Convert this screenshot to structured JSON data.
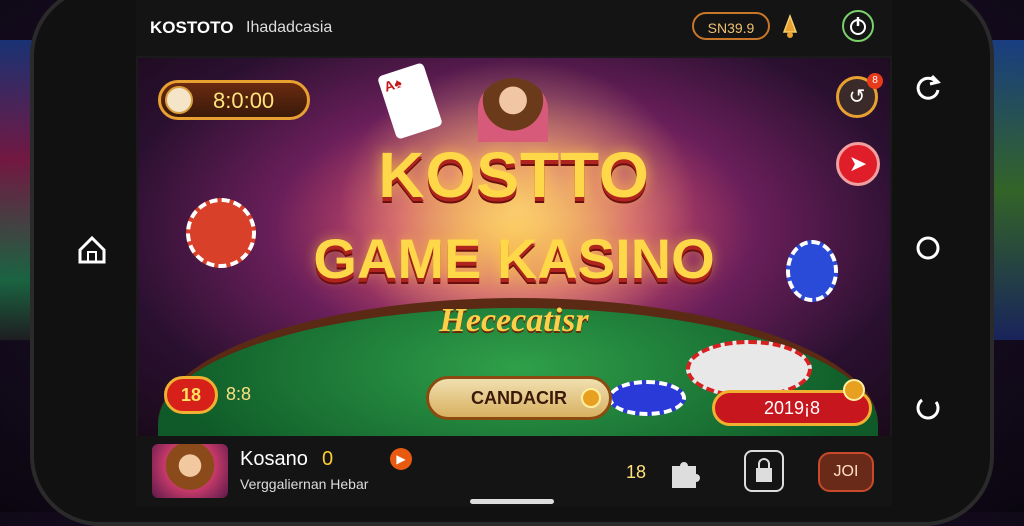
{
  "topbar": {
    "brand": "KOSTOTO",
    "subtitle": "Ihadadcasia",
    "balance": "SN39.9"
  },
  "game": {
    "timer": "8:0:00",
    "title_line1": "KOSTTO",
    "title_line2": "GAME KASINO",
    "title_line3": "Hececatisr",
    "card_suit": "A♠",
    "bet_left_badge": "18",
    "bet_left_value": "8:8",
    "cta_label": "CANDACIR",
    "score_value": "2019¡8",
    "share_badge": "8"
  },
  "bottombar": {
    "user_name": "Kosano",
    "user_count": "0",
    "user_subtitle": "Verggaliernan Hebar",
    "level": "18",
    "right_button": "JOI"
  },
  "icons": {
    "home": "home-icon",
    "power": "power-icon",
    "share": "share-icon",
    "next": "arrow-icon",
    "puzzle": "puzzle-icon",
    "alarm": "bell-icon"
  },
  "colors": {
    "accent": "#e8a030",
    "title": "#ffd84a",
    "danger": "#e01e2a",
    "table": "#2fa04a"
  }
}
